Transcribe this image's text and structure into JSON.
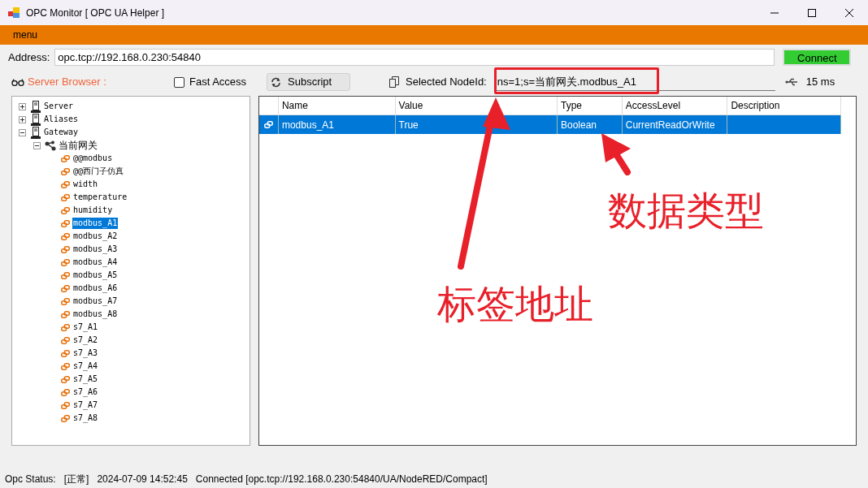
{
  "window": {
    "title": "OPC Monitor [ OPC UA Helper ]"
  },
  "menu": {
    "label": "menu"
  },
  "address": {
    "label": "Address:",
    "value": "opc.tcp://192.168.0.230:54840",
    "connect_button": "Connect"
  },
  "toolbar": {
    "server_browser": "Server Browser :",
    "fast_access": {
      "label": "Fast Access",
      "checked": false
    },
    "subscript_button": "Subscript",
    "node_id_label": "Selected NodeId:",
    "node_id_value": "ns=1;s=当前网关.modbus_A1",
    "latency": "15 ms"
  },
  "tree": [
    {
      "label": "Server",
      "kind": "server",
      "expanded": false,
      "selected": false
    },
    {
      "label": "Aliases",
      "kind": "server",
      "expanded": false,
      "selected": false
    },
    {
      "label": "Gateway",
      "kind": "server",
      "expanded": true,
      "selected": false,
      "children": [
        {
          "label": "当前网关",
          "kind": "folder",
          "expanded": true,
          "selected": false,
          "children": [
            {
              "label": "@@modbus",
              "kind": "tag",
              "selected": false
            },
            {
              "label": "@@西门子仿真",
              "kind": "tag",
              "selected": false
            },
            {
              "label": "width",
              "kind": "tag",
              "selected": false
            },
            {
              "label": "temperature",
              "kind": "tag",
              "selected": false
            },
            {
              "label": "humidity",
              "kind": "tag",
              "selected": false
            },
            {
              "label": "modbus_A1",
              "kind": "tag",
              "selected": true
            },
            {
              "label": "modbus_A2",
              "kind": "tag",
              "selected": false
            },
            {
              "label": "modbus_A3",
              "kind": "tag",
              "selected": false
            },
            {
              "label": "modbus_A4",
              "kind": "tag",
              "selected": false
            },
            {
              "label": "modbus_A5",
              "kind": "tag",
              "selected": false
            },
            {
              "label": "modbus_A6",
              "kind": "tag",
              "selected": false
            },
            {
              "label": "modbus_A7",
              "kind": "tag",
              "selected": false
            },
            {
              "label": "modbus_A8",
              "kind": "tag",
              "selected": false
            },
            {
              "label": "s7_A1",
              "kind": "tag",
              "selected": false
            },
            {
              "label": "s7_A2",
              "kind": "tag",
              "selected": false
            },
            {
              "label": "s7_A3",
              "kind": "tag",
              "selected": false
            },
            {
              "label": "s7_A4",
              "kind": "tag",
              "selected": false
            },
            {
              "label": "s7_A5",
              "kind": "tag",
              "selected": false
            },
            {
              "label": "s7_A6",
              "kind": "tag",
              "selected": false
            },
            {
              "label": "s7_A7",
              "kind": "tag",
              "selected": false
            },
            {
              "label": "s7_A8",
              "kind": "tag",
              "selected": false
            }
          ]
        }
      ]
    }
  ],
  "table": {
    "columns": [
      "Name",
      "Value",
      "Type",
      "AccessLevel",
      "Description"
    ],
    "rows": [
      {
        "cells": [
          "modbus_A1",
          "True",
          "Boolean",
          "CurrentReadOrWrite",
          ""
        ],
        "selected": true
      }
    ]
  },
  "annotations": [
    {
      "text": "标签地址"
    },
    {
      "text": "数据类型"
    }
  ],
  "status_bar": {
    "label": "Opc Status:",
    "state": "[正常]",
    "time": "2024-07-09 14:52:45",
    "message": "Connected [opc.tcp://192.168.0.230:54840/UA/NodeRED/Compact]"
  }
}
